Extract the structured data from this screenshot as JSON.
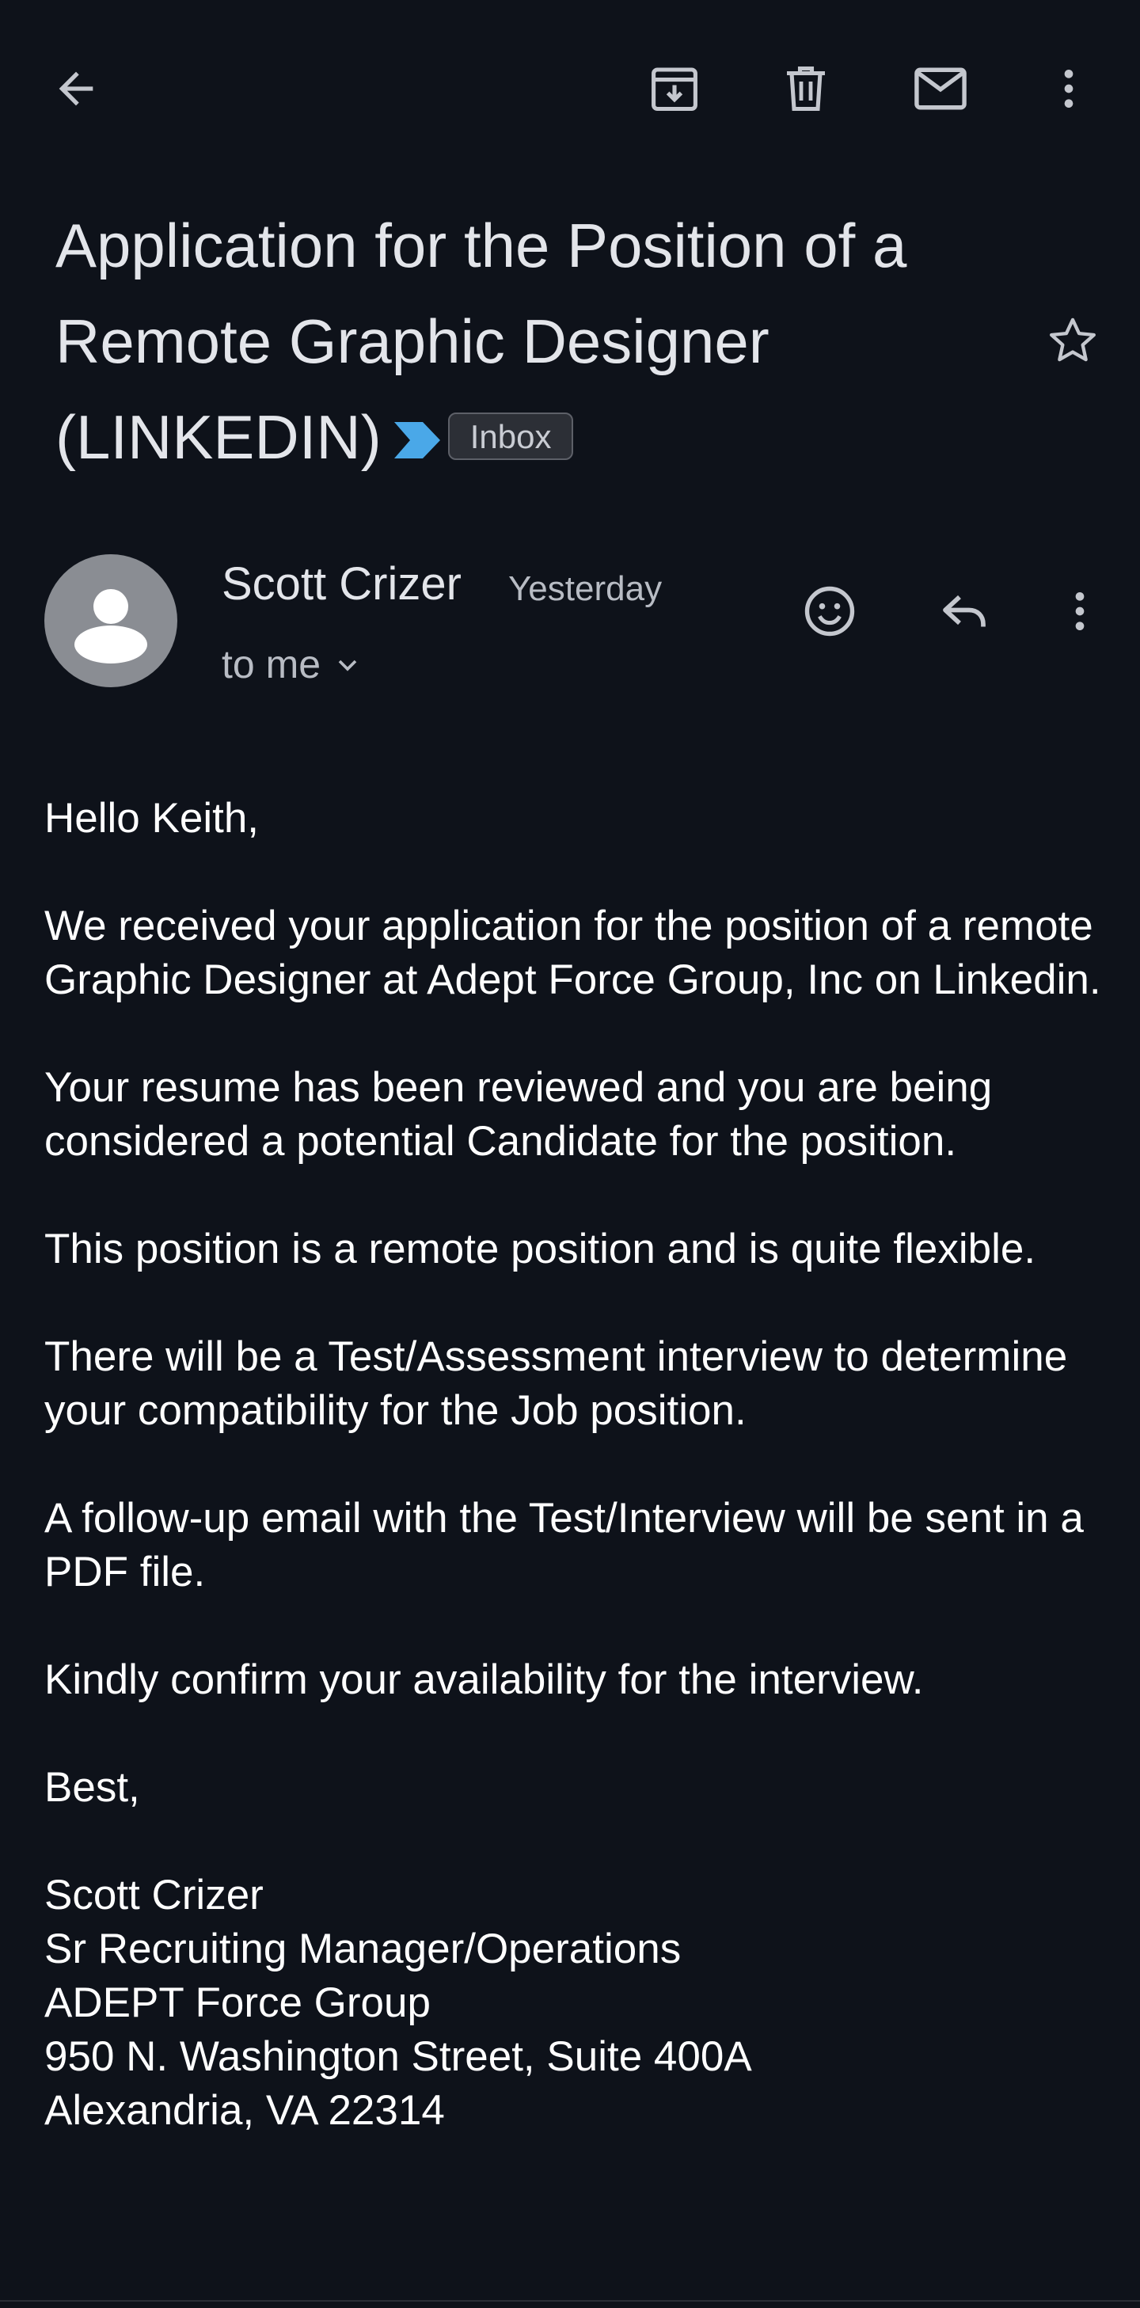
{
  "toolbar": {
    "back_icon": "arrow-left-icon",
    "archive_icon": "archive-icon",
    "delete_icon": "trash-icon",
    "mark_unread_icon": "mail-icon",
    "more_icon": "more-vertical-icon"
  },
  "email": {
    "subject": "Application for the Position of a Remote Graphic Designer (LINKEDIN)",
    "label_chip": "Inbox",
    "importance_marker_color": "#4aa8e8",
    "sender": {
      "name": "Scott Crizer",
      "time": "Yesterday",
      "recipient": "to me"
    },
    "body": {
      "greeting": "Hello Keith,",
      "paragraphs": [
        "We received your application for the position of a remote Graphic Designer at Adept Force Group, Inc on Linkedin.",
        "Your resume has been reviewed and you are being considered a potential Candidate for the position.",
        "This position is a remote position and is quite flexible.",
        "There will be a Test/Assessment interview to determine your compatibility for the Job position.",
        "A follow-up email with the Test/Interview will be sent in a PDF file.",
        "Kindly confirm your availability for the interview."
      ],
      "closing": "Best,",
      "signature": [
        "Scott Crizer",
        "Sr Recruiting Manager/Operations",
        "ADEPT Force Group",
        "950 N. Washington Street, Suite 400A",
        "Alexandria, VA 22314"
      ]
    }
  },
  "colors": {
    "background": "#0e121a",
    "text": "#ffffff",
    "secondary_text": "#b8bcc4",
    "icon": "#c4c7ce"
  }
}
